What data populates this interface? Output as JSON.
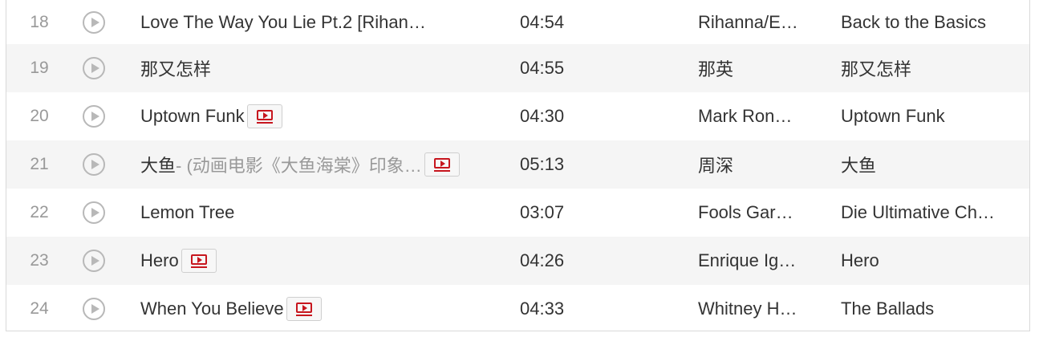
{
  "colors": {
    "mv_icon": "#c7161e",
    "alt_row_bg": "#f5f5f5",
    "muted_text": "#999999"
  },
  "rows": [
    {
      "num": "18",
      "title": "Love The Way You Lie Pt.2 [Rihan…",
      "subtitle": "",
      "has_mv": false,
      "duration": "04:54",
      "artist": "Rihanna/E…",
      "album": "Back to the Basics"
    },
    {
      "num": "19",
      "title": "那又怎样",
      "subtitle": "",
      "has_mv": false,
      "duration": "04:55",
      "artist": "那英",
      "album": "那又怎样"
    },
    {
      "num": "20",
      "title": "Uptown Funk",
      "subtitle": "",
      "has_mv": true,
      "duration": "04:30",
      "artist": "Mark Ron…",
      "album": "Uptown Funk"
    },
    {
      "num": "21",
      "title": "大鱼",
      "subtitle": " - (动画电影《大鱼海棠》印象…",
      "has_mv": true,
      "duration": "05:13",
      "artist": "周深",
      "album": "大鱼"
    },
    {
      "num": "22",
      "title": "Lemon Tree",
      "subtitle": "",
      "has_mv": false,
      "duration": "03:07",
      "artist": "Fools Gar…",
      "album": "Die Ultimative Ch…"
    },
    {
      "num": "23",
      "title": "Hero",
      "subtitle": "",
      "has_mv": true,
      "duration": "04:26",
      "artist": "Enrique Ig…",
      "album": "Hero"
    },
    {
      "num": "24",
      "title": "When You Believe",
      "subtitle": "",
      "has_mv": true,
      "duration": "04:33",
      "artist": "Whitney H…",
      "album": "The Ballads"
    }
  ]
}
